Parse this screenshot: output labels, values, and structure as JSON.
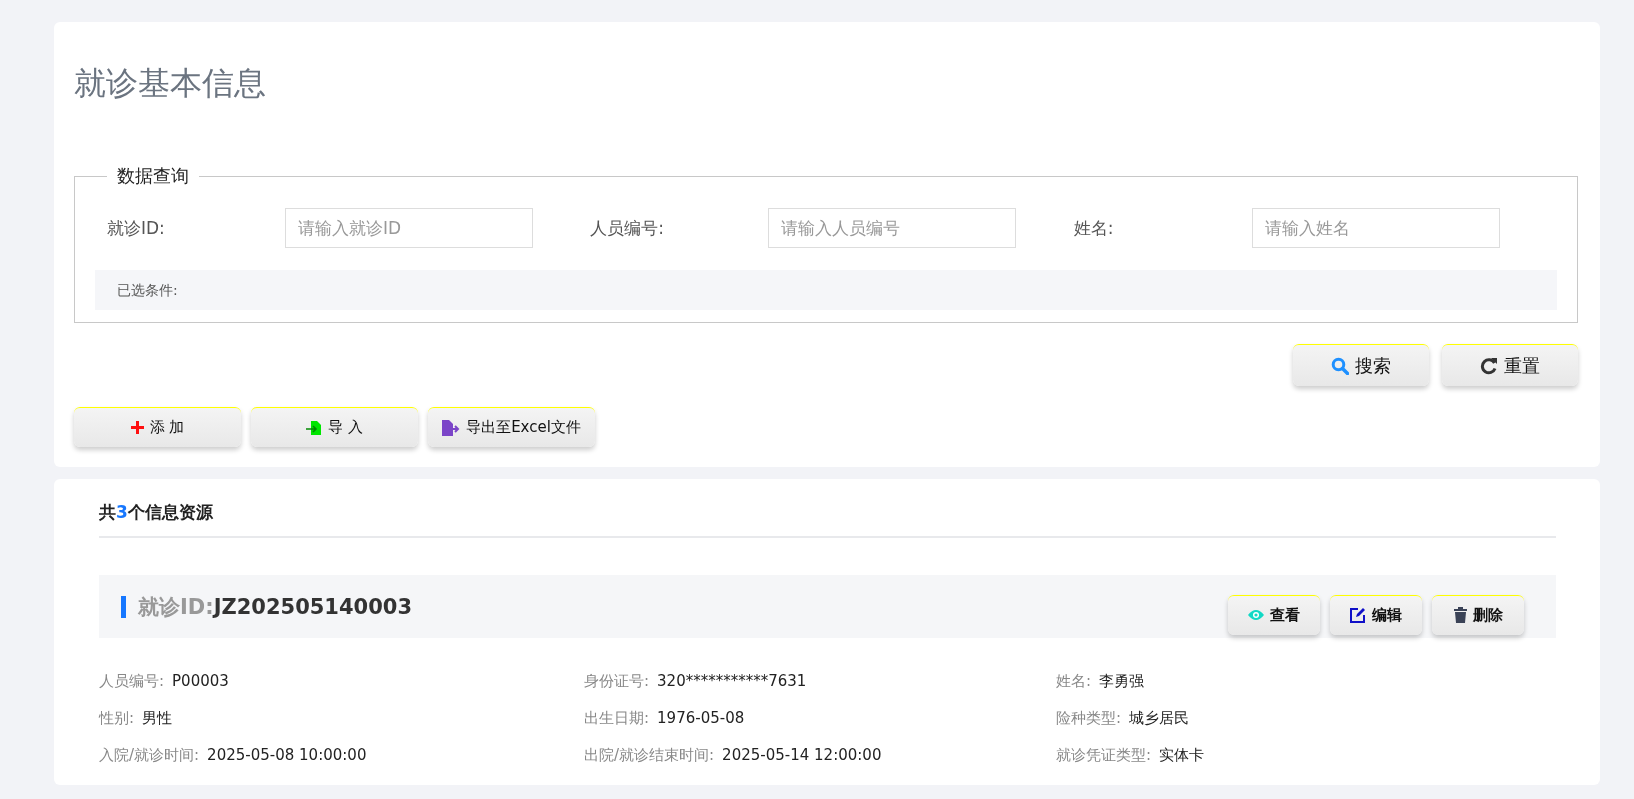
{
  "page_title": "就诊基本信息",
  "query": {
    "legend": "数据查询",
    "fields": [
      {
        "label": "就诊ID:",
        "placeholder": "请输入就诊ID"
      },
      {
        "label": "人员编号:",
        "placeholder": "请输入人员编号"
      },
      {
        "label": "姓名:",
        "placeholder": "请输入姓名"
      }
    ],
    "selected_conditions_label": "已选条件:",
    "buttons": [
      {
        "kind": "search",
        "label": "搜索"
      },
      {
        "kind": "reset",
        "label": "重置"
      }
    ]
  },
  "actions": [
    {
      "kind": "add",
      "label": "添 加"
    },
    {
      "kind": "import",
      "label": "导 入"
    },
    {
      "kind": "export",
      "label": "导出至Excel文件"
    }
  ],
  "results": {
    "prefix": "共",
    "count": "3",
    "suffix": "个信息资源",
    "records": [
      {
        "id_label": "就诊ID:",
        "id_value": "JZ202505140003",
        "buttons": [
          {
            "kind": "view",
            "label": "查看"
          },
          {
            "kind": "edit",
            "label": "编辑"
          },
          {
            "kind": "delete",
            "label": "删除"
          }
        ],
        "fields": [
          {
            "label": "人员编号:",
            "value": "P00003"
          },
          {
            "label": "身份证号:",
            "value": "320***********7631"
          },
          {
            "label": "姓名:",
            "value": "李勇强"
          },
          {
            "label": "性别:",
            "value": "男性"
          },
          {
            "label": "出生日期:",
            "value": "1976-05-08"
          },
          {
            "label": "险种类型:",
            "value": "城乡居民"
          },
          {
            "label": "入院/就诊时间:",
            "value": "2025-05-08 10:00:00"
          },
          {
            "label": "出院/就诊结束时间:",
            "value": "2025-05-14 12:00:00"
          },
          {
            "label": "就诊凭证类型:",
            "value": "实体卡"
          }
        ]
      }
    ]
  }
}
